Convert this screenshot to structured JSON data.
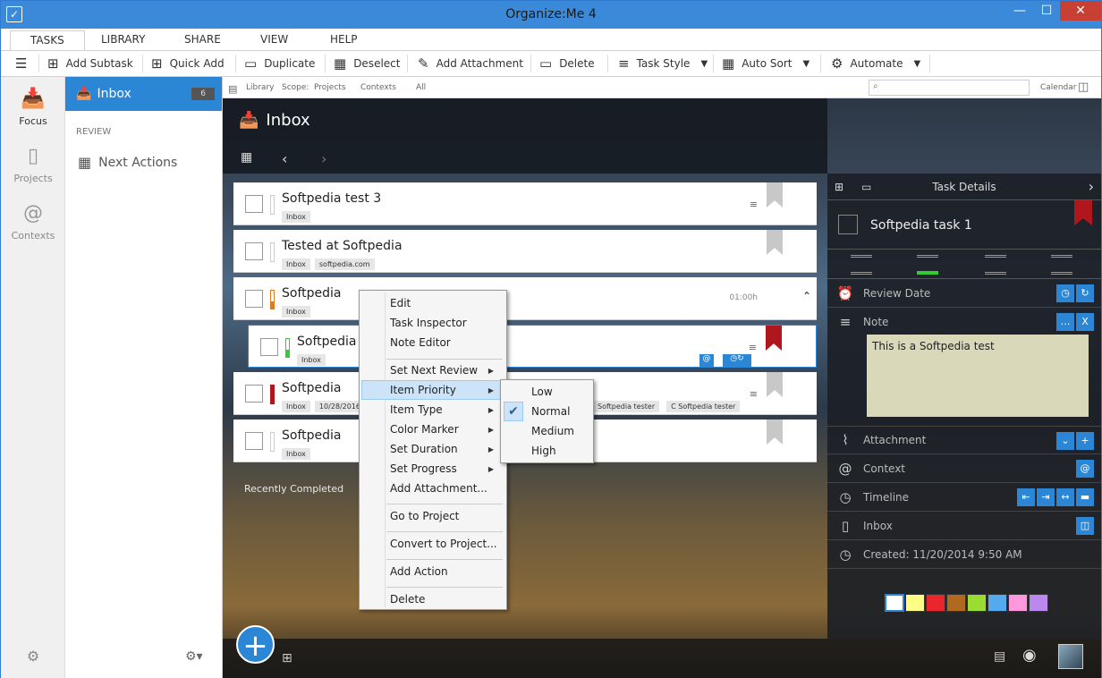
{
  "window": {
    "title": "Organize:Me 4"
  },
  "ribbon": {
    "tabs": [
      "TASKS",
      "LIBRARY",
      "SHARE",
      "VIEW",
      "HELP"
    ]
  },
  "toolbar": {
    "add_subtask": "Add Subtask",
    "quick_add": "Quick Add",
    "duplicate": "Duplicate",
    "deselect": "Deselect",
    "add_attachment": "Add Attachment",
    "delete": "Delete",
    "task_style": "Task Style",
    "auto_sort": "Auto Sort",
    "automate": "Automate"
  },
  "leftnav": {
    "focus": "Focus",
    "projects": "Projects",
    "contexts": "Contexts"
  },
  "sidebar": {
    "inbox": "Inbox",
    "inbox_count": "6",
    "review": "REVIEW",
    "next_actions": "Next Actions"
  },
  "scopebar": {
    "library": "Library",
    "scope": "Scope:",
    "projects": "Projects",
    "contexts": "Contexts",
    "all": "All",
    "calendar": "Calendar"
  },
  "header": {
    "title": "Inbox"
  },
  "tasks": [
    {
      "name": "Softpedia test 3",
      "tags": [
        "Inbox"
      ]
    },
    {
      "name": "Tested at Softpedia",
      "tags": [
        "Inbox",
        "softpedia.com"
      ]
    },
    {
      "name": "Softpedia",
      "tags": [
        "Inbox"
      ],
      "duration": "01:00h"
    },
    {
      "name": "Softpedia ta",
      "tags": [
        "Inbox"
      ]
    },
    {
      "name": "Softpedia",
      "tags": [
        "Inbox",
        "10/28/2016"
      ],
      "extra_tags": [
        "Softpedia tester",
        "C Softpedia tester"
      ]
    },
    {
      "name": "Softpedia",
      "tags": [
        "Inbox"
      ]
    }
  ],
  "recently_completed": "Recently Completed",
  "details": {
    "heading": "Task Details",
    "task_name": "Softpedia task 1",
    "review_date": "Review Date",
    "note_label": "Note",
    "note_text": "This is a Softpedia test",
    "attachment": "Attachment",
    "context": "Context",
    "timeline": "Timeline",
    "inbox": "Inbox",
    "created": "Created: 11/20/2014 9:50 AM",
    "colors": [
      "#ffffff",
      "#ffff88",
      "#e8262b",
      "#b06a20",
      "#99dd33",
      "#55aaee",
      "#ff99dd",
      "#bb88ee"
    ]
  },
  "context_menu": {
    "items": [
      "Edit",
      "Task Inspector",
      "Note Editor",
      "Set Next Review",
      "Item Priority",
      "Item Type",
      "Color Marker",
      "Set Duration",
      "Set Progress",
      "Add Attachment...",
      "Go to Project",
      "Convert to Project...",
      "Add Action",
      "Delete"
    ]
  },
  "priority_menu": {
    "items": [
      "Low",
      "Normal",
      "Medium",
      "High"
    ],
    "selected": "Normal"
  }
}
